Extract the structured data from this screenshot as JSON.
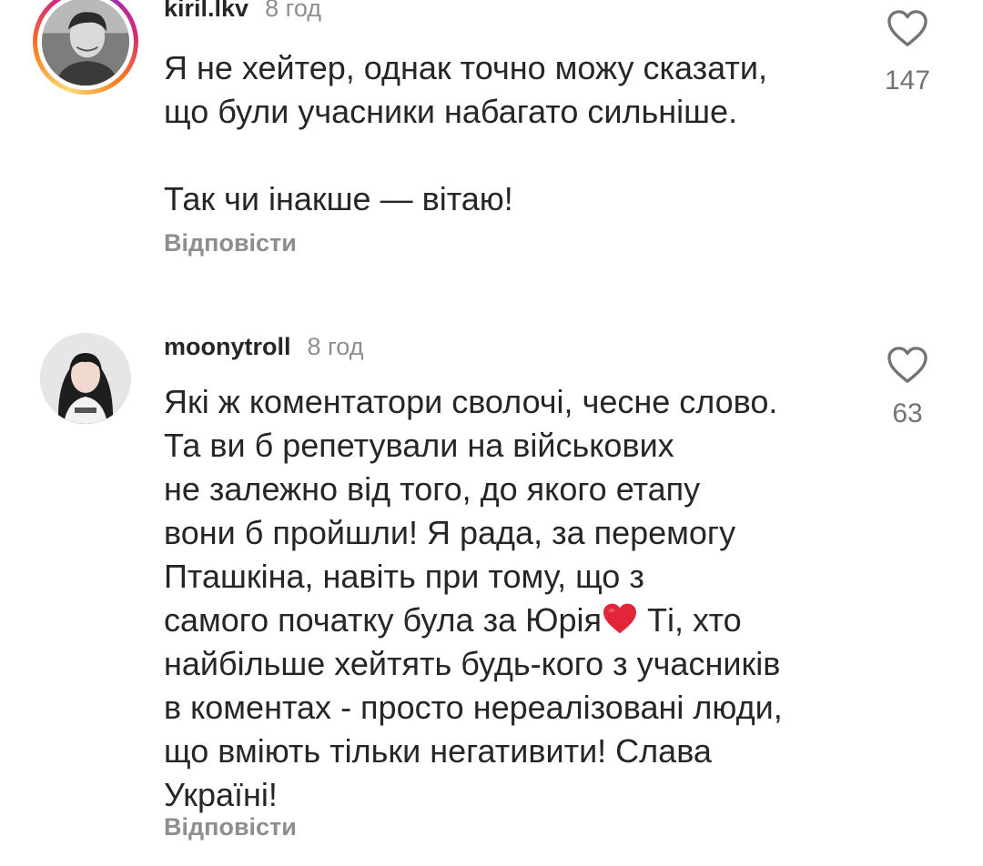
{
  "comments": [
    {
      "username": "kiril.lkv",
      "time": "8 год",
      "text": "Я не хейтер, однак точно можу сказати,\nщо були учасники набагато сильніше.\n\nТак чи інакше — вітаю!",
      "reply_label": "Відповісти",
      "like_count": "147",
      "avatar_story_ring": true
    },
    {
      "username": "moonytroll",
      "time": "8 год",
      "text_before_emoji": "Які ж коментатори сволочі, чесне слово.\nТа ви б репетували на військових\nне залежно від того, до якого етапу\nвони б пройшли!  Я рада, за перемогу\nПташкіна, навіть при тому, що з\nсамого початку була за Юрія",
      "emoji": "red-heart",
      "text_after_emoji": " Ті, хто\nнайбільше хейтять будь-кого з учасників\nв коментах - просто нереалізовані люди,\nщо вміють тільки негативити! Слава\nУкраїні!",
      "reply_label": "Відповісти",
      "like_count": "63",
      "avatar_story_ring": false
    }
  ],
  "colors": {
    "text": "#262626",
    "secondary": "#8e8e8e",
    "count": "#737373",
    "emoji_heart": "#e2263a"
  },
  "icons": {
    "like": "heart-outline-icon",
    "emoji": "red-heart-emoji"
  }
}
